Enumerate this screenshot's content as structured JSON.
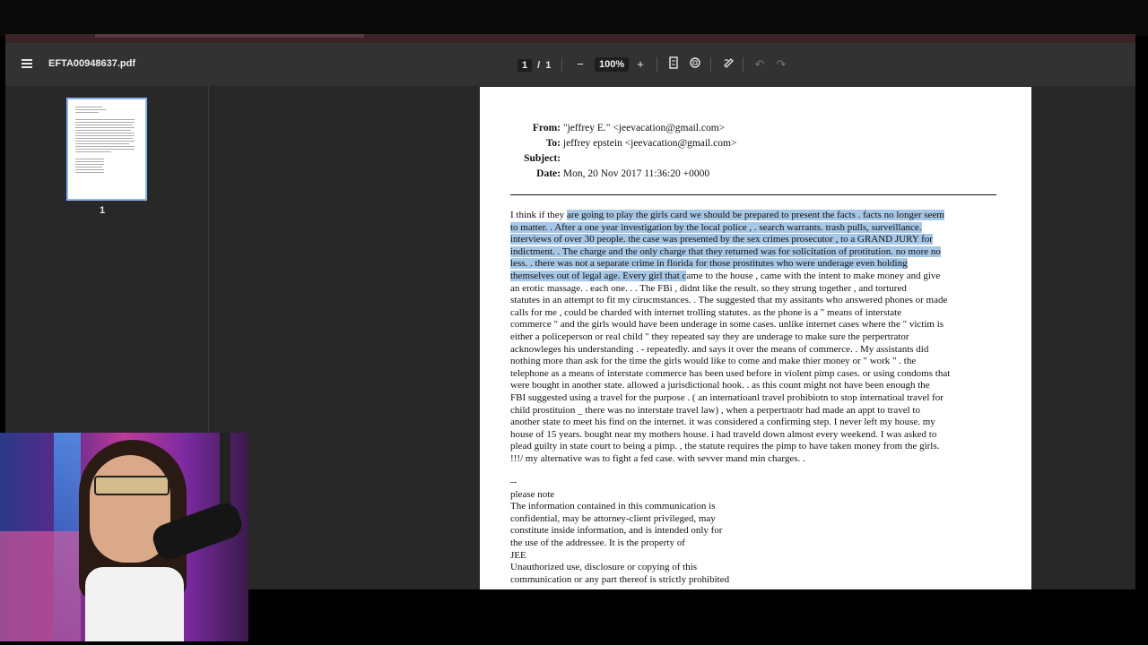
{
  "toolbar": {
    "filename": "EFTA00948637.pdf",
    "page_current": "1",
    "page_sep": "/",
    "page_total": "1",
    "zoom": "100%",
    "icons": [
      "menu-icon",
      "zoom-out-icon",
      "zoom-in-icon",
      "fit-page-icon",
      "rotate-icon",
      "annotate-icon",
      "undo-icon",
      "redo-icon"
    ]
  },
  "sidebar": {
    "thumb_label": "1"
  },
  "email": {
    "from_label": "From:",
    "from_value": "\"jeffrey E.\" <jeevacation@gmail.com>",
    "to_label": "To:",
    "to_value": "jeffrey epstein <jeevacation@gmail.com>",
    "subject_label": "Subject:",
    "subject_value": "",
    "date_label": "Date:",
    "date_value": "Mon, 20 Nov 2017 11:36:20 +0000",
    "body_lines": [
      [
        "I think if they ",
        "are going to play the girls card  we should be prepared to present the facts  .    facts no longer seem",
        ""
      ],
      [
        "",
        "to matter.  .    After a one year investigation by the local police ,  . search warrants. trash pulls,  surveillance.",
        ""
      ],
      [
        "",
        "interviews of over 30 people.   the case was presented by the sex crimes  prosecutor , to a GRAND JURY  for",
        ""
      ],
      [
        "",
        "indictment.  .  The charge  and the  only charge that they returned was for solicitation of protitution.   no more no",
        ""
      ],
      [
        "",
        "less.  .   there was not a separate crime in florida for those prostitutes  who were underage  even holding",
        ""
      ],
      [
        "",
        "themselves out of legal age.   Every girl that c",
        "ame to the house , came with the intent to make money  and give"
      ],
      [
        "an erotic massage.  .  each one.   .   .   The FBi , didnt like the result. so they strung together , and tortured",
        "",
        ""
      ],
      [
        "statutes  in an attempt to fit my cirucmstances.   .  The suggested that my assitants who answered phones or made",
        "",
        ""
      ],
      [
        "calls for me   ,  could be charded with internet trolling statutes.    as the phone is a \" means of interstate",
        "",
        ""
      ],
      [
        "commerce \"  and the girls would have been underage in some cases.    unlike internet cases where the \" victim is",
        "",
        ""
      ],
      [
        "either a policeperson or real child  \" they repeated say they are underage to make sure the perpertrator",
        "",
        ""
      ],
      [
        "acknowleges his understanding . - repeatedly. and   says it over the means   of commerce.  .    My assistants did",
        "",
        ""
      ],
      [
        "nothing more than ask for  the time the girls would like to come and make thier money or \" work \" .   the",
        "",
        ""
      ],
      [
        "telephone as a means of interstate commerce has been used before in violent pimp cases.   or using condoms that",
        "",
        ""
      ],
      [
        "were bought in another state.  allowed a jurisdictional hook.  .   as this count might not have been enough  the",
        "",
        ""
      ],
      [
        "FBI  suggested using a travel for the purpose .  ( an internatioanl travel prohibiotn to stop internatioal travel for",
        "",
        ""
      ],
      [
        "child prostituion _  there was no interstate travel law)    ,  when a perpertraotr  had made an appt to travel to",
        "",
        ""
      ],
      [
        "another state to meet his find on the internet.  it was considered a confirming step.   I never left my house.   my",
        "",
        ""
      ],
      [
        "house of 15 years.  bought near my mothers house.   i had traveld down almost every weekend.     I was asked to",
        "",
        ""
      ],
      [
        "plead guilty in state court to being a pimp.   , the statute requires the pimp to have taken money from the girls.",
        "",
        ""
      ],
      [
        "!!!/     my alternative was to fight a fed case. with sevver  mand min  charges.  .",
        "",
        ""
      ]
    ],
    "signature_lines": [
      "--",
      "       please note",
      "The information contained in this communication is",
      "confidential, may be attorney-client privileged, may",
      "constitute inside information, and is intended only for",
      "the use of the addressee. It is the property of",
      "JEE",
      "Unauthorized use, disclosure or copying of this",
      "communication or any part thereof is strictly prohibited"
    ]
  }
}
